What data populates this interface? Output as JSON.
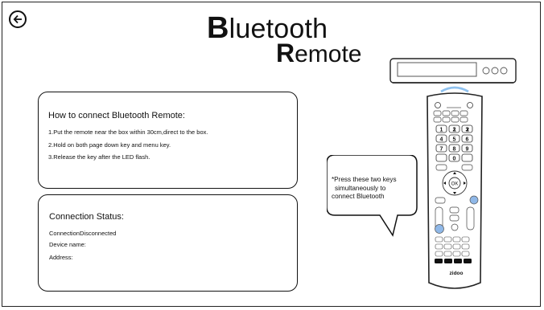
{
  "header": {
    "title_word1_cap": "B",
    "title_word1_rest": "luetooth",
    "title_word2_cap": "R",
    "title_word2_rest": "emote"
  },
  "instructions": {
    "heading": "How to connect Bluetooth Remote:",
    "steps": [
      "1.Put the remote near the box within 30cm,direct to the box.",
      "2.Hold on both page down key and menu key.",
      "3.Release the key after the LED flash."
    ]
  },
  "status": {
    "heading": "Connection Status:",
    "connection_label": "Connection:",
    "connection_value": "Disconnected",
    "device_label": "Device name:",
    "device_value": "",
    "address_label": "Address:",
    "address_value": ""
  },
  "tip": {
    "lines": [
      "*Press these two keys",
      "simultaneously to",
      "connect Bluetooth"
    ]
  },
  "remote": {
    "brand": "zidoo",
    "keypad": [
      "1",
      "2",
      "3",
      "4",
      "5",
      "6",
      "7",
      "8",
      "9",
      "0"
    ],
    "ok_label": "OK",
    "highlight_color": "#8fb8e8",
    "signal_color": "#8fc2f0"
  },
  "icons": {
    "back": "back-arrow-icon"
  }
}
